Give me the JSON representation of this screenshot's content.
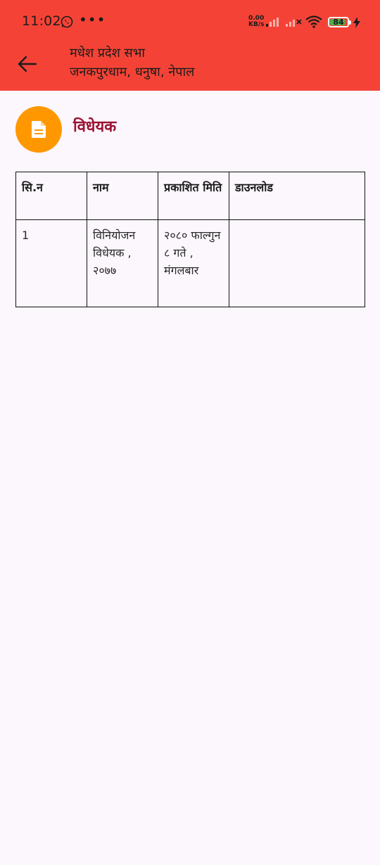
{
  "status_bar": {
    "time": "11:02",
    "network_speed_value": "0.00",
    "network_speed_unit": "KB/s",
    "battery_level": "84",
    "icons": [
      "whatsapp-icon",
      "more-dots-icon",
      "signal-icon",
      "signal-off-icon",
      "wifi-icon",
      "battery-icon",
      "charging-bolt-icon"
    ]
  },
  "app_bar": {
    "title": "मधेश प्रदेश सभा",
    "subtitle": "जनकपुरधाम, धनुषा, नेपाल",
    "background_color": "#f44336"
  },
  "section": {
    "title": "विधेयक",
    "icon": "document-icon",
    "icon_bg_color": "#ff9800",
    "title_color": "#9b1232"
  },
  "table": {
    "columns": [
      "सि.न",
      "नाम",
      "प्रकाशित मिति",
      "डाउनलोड"
    ],
    "rows": [
      {
        "sn": "1",
        "name": "विनियोजन विधेयक , २०७७",
        "published_date": "२०८० फाल्गुन ८ गते , मंगलबार",
        "download": ""
      }
    ]
  }
}
